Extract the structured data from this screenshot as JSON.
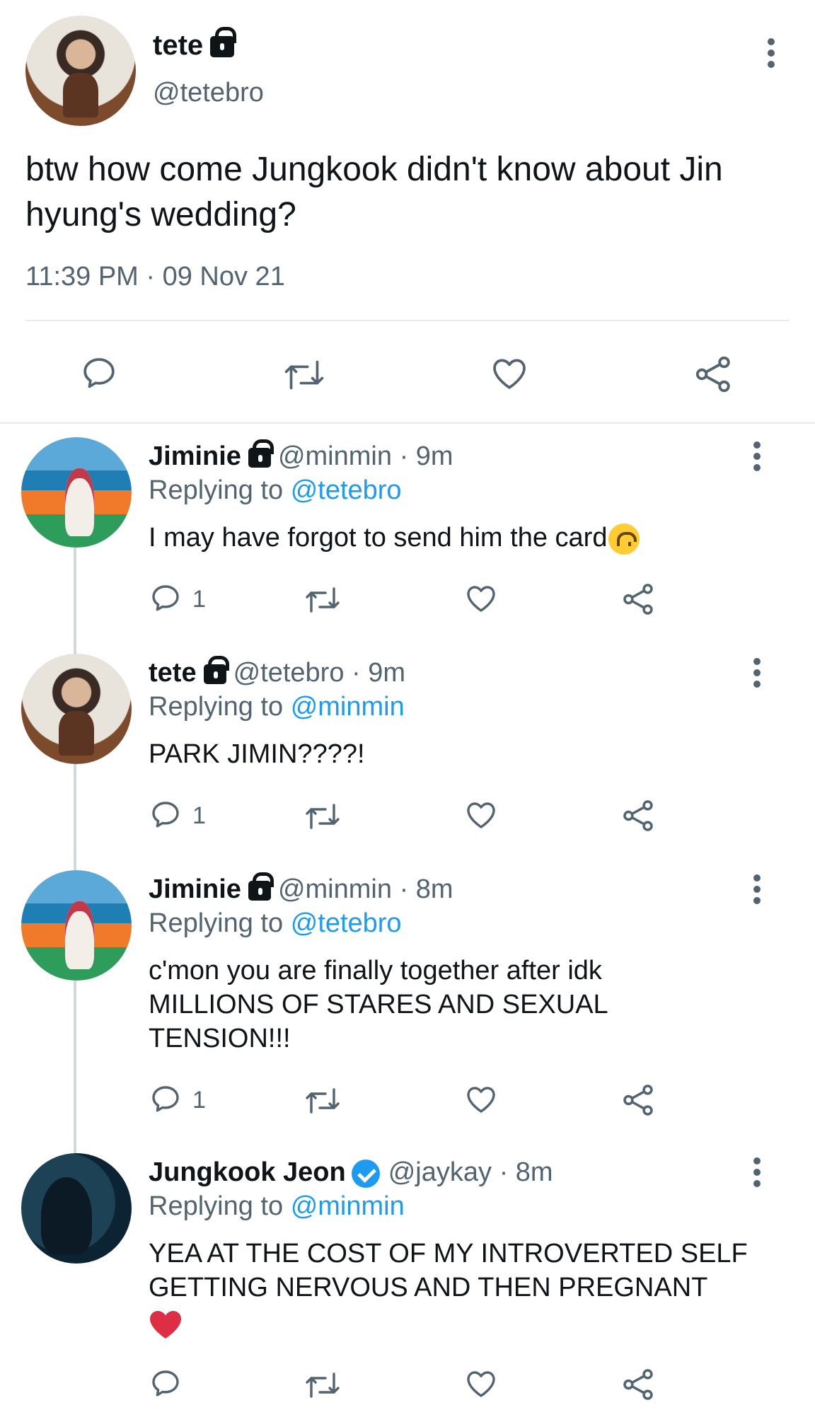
{
  "main_tweet": {
    "author_name": "tete",
    "author_handle": "@tetebro",
    "text": "btw how come Jungkook didn't know about Jin hyung's wedding?",
    "timestamp": "11:39 PM · 09 Nov 21",
    "avatar_icon": "avatar-photo"
  },
  "replies": [
    {
      "name": "Jiminie",
      "handle": "@minmin",
      "time": "· 9m",
      "replying_prefix": "Replying to",
      "replying_to": "@tetebro",
      "text": "I may have forgot to send him the card",
      "emoji": "upside-down-face-emoji",
      "reply_count": "1",
      "protected": true
    },
    {
      "name": "tete",
      "handle": "@tetebro",
      "time": "· 9m",
      "replying_prefix": "Replying to",
      "replying_to": "@minmin",
      "text": "PARK JIMIN????!",
      "reply_count": "1",
      "protected": true
    },
    {
      "name": "Jiminie",
      "handle": "@minmin",
      "time": "· 8m",
      "replying_prefix": "Replying to",
      "replying_to": "@tetebro",
      "text": "c'mon you are finally together after idk MILLIONS OF STARES AND SEXUAL TENSION!!!",
      "reply_count": "1",
      "protected": true
    },
    {
      "name": "Jungkook Jeon",
      "handle": "@jaykay",
      "time": "· 8m",
      "replying_prefix": "Replying to",
      "replying_to": "@minmin",
      "text": "YEA AT THE COST OF MY INTROVERTED SELF GETTING NERVOUS AND THEN PREGNANT",
      "emoji": "red-heart-emoji",
      "reply_count": "",
      "verified": true
    }
  ],
  "colors": {
    "text_primary": "#0f1419",
    "text_secondary": "#536471",
    "accent": "#1d9bf0",
    "divider": "#e6ecf0",
    "thread_line": "#cfd9de",
    "heart_emoji": "#dd2e44"
  }
}
